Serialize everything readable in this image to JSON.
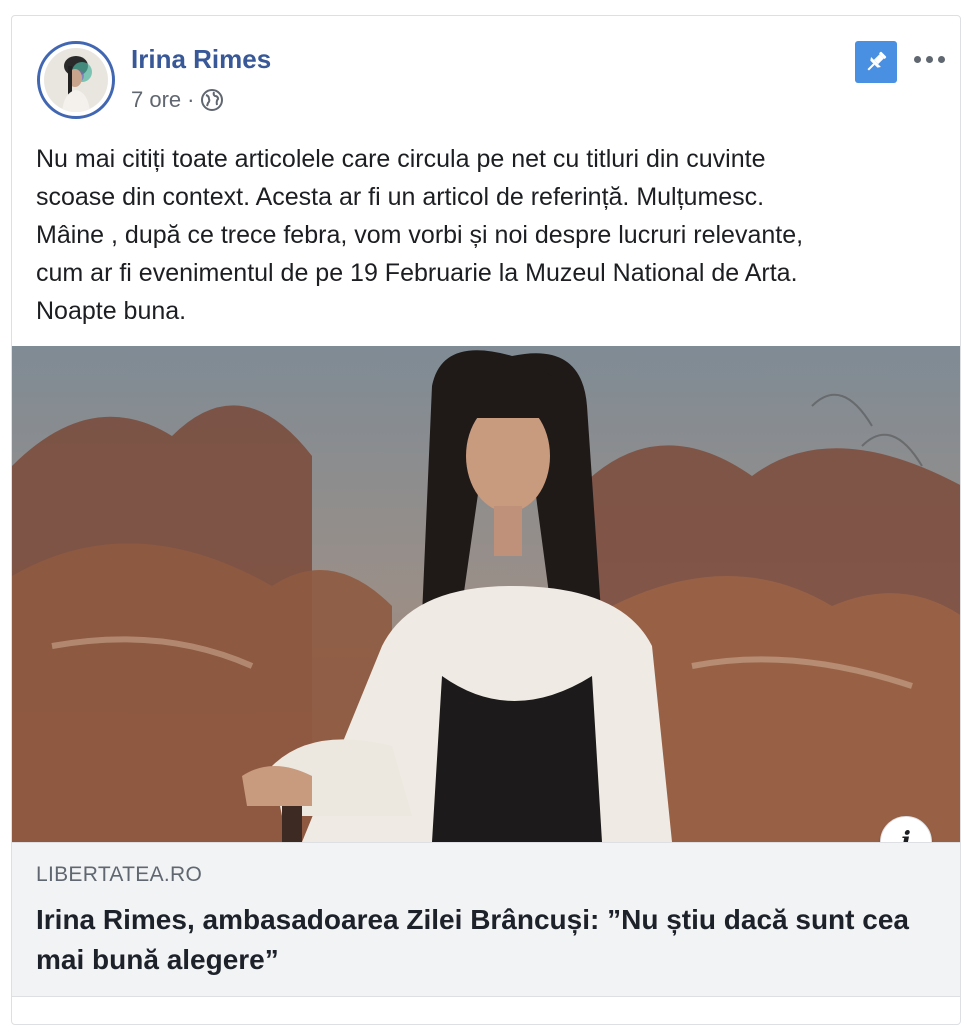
{
  "post": {
    "author_name": "Irina Rimes",
    "timestamp": "7 ore",
    "separator": "·",
    "privacy_icon": "globe-icon",
    "pin_icon": "pin-icon",
    "more_icon": "more-options-icon",
    "body_text": "Nu mai citiți toate articolele care circula pe net cu titluri din cuvinte\nscoase din context. Acesta ar fi un articol de referință. Mulțumesc.\nMâine , după ce trece febra, vom vorbi și noi despre lucruri relevante,\ncum ar fi evenimentul de pe 19 Februarie la Muzeul National de Arta.\nNoapte buna."
  },
  "link_preview": {
    "domain": "LIBERTATEA.RO",
    "title": "Irina Rimes, ambasadoarea Zilei Brâncuși: ”Nu știu dacă sunt cea mai bună alegere”",
    "info_label": "i"
  },
  "colors": {
    "author_link": "#385898",
    "pin_button": "#4a90e2",
    "meta_text": "#606770",
    "footer_bg": "#f2f3f5"
  }
}
